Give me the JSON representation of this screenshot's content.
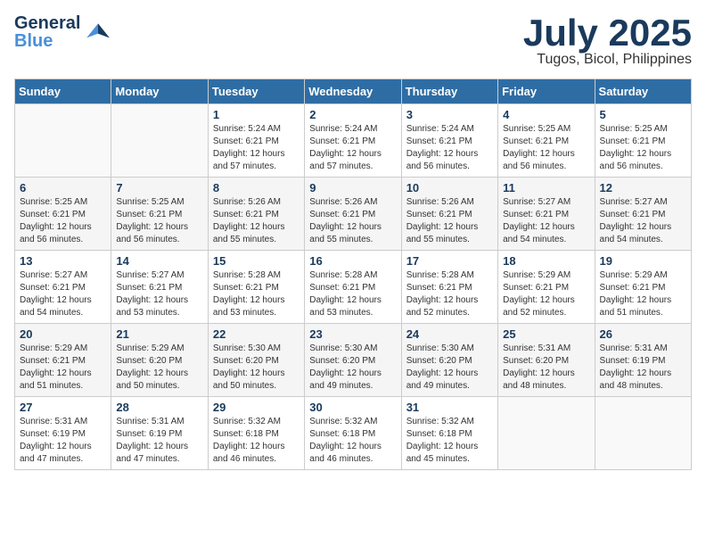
{
  "logo": {
    "general": "General",
    "blue": "Blue",
    "bird_symbol": "🐦"
  },
  "header": {
    "month": "July 2025",
    "location": "Tugos, Bicol, Philippines"
  },
  "weekdays": [
    "Sunday",
    "Monday",
    "Tuesday",
    "Wednesday",
    "Thursday",
    "Friday",
    "Saturday"
  ],
  "weeks": [
    [
      {
        "day": "",
        "info": ""
      },
      {
        "day": "",
        "info": ""
      },
      {
        "day": "1",
        "info": "Sunrise: 5:24 AM\nSunset: 6:21 PM\nDaylight: 12 hours and 57 minutes."
      },
      {
        "day": "2",
        "info": "Sunrise: 5:24 AM\nSunset: 6:21 PM\nDaylight: 12 hours and 57 minutes."
      },
      {
        "day": "3",
        "info": "Sunrise: 5:24 AM\nSunset: 6:21 PM\nDaylight: 12 hours and 56 minutes."
      },
      {
        "day": "4",
        "info": "Sunrise: 5:25 AM\nSunset: 6:21 PM\nDaylight: 12 hours and 56 minutes."
      },
      {
        "day": "5",
        "info": "Sunrise: 5:25 AM\nSunset: 6:21 PM\nDaylight: 12 hours and 56 minutes."
      }
    ],
    [
      {
        "day": "6",
        "info": "Sunrise: 5:25 AM\nSunset: 6:21 PM\nDaylight: 12 hours and 56 minutes."
      },
      {
        "day": "7",
        "info": "Sunrise: 5:25 AM\nSunset: 6:21 PM\nDaylight: 12 hours and 56 minutes."
      },
      {
        "day": "8",
        "info": "Sunrise: 5:26 AM\nSunset: 6:21 PM\nDaylight: 12 hours and 55 minutes."
      },
      {
        "day": "9",
        "info": "Sunrise: 5:26 AM\nSunset: 6:21 PM\nDaylight: 12 hours and 55 minutes."
      },
      {
        "day": "10",
        "info": "Sunrise: 5:26 AM\nSunset: 6:21 PM\nDaylight: 12 hours and 55 minutes."
      },
      {
        "day": "11",
        "info": "Sunrise: 5:27 AM\nSunset: 6:21 PM\nDaylight: 12 hours and 54 minutes."
      },
      {
        "day": "12",
        "info": "Sunrise: 5:27 AM\nSunset: 6:21 PM\nDaylight: 12 hours and 54 minutes."
      }
    ],
    [
      {
        "day": "13",
        "info": "Sunrise: 5:27 AM\nSunset: 6:21 PM\nDaylight: 12 hours and 54 minutes."
      },
      {
        "day": "14",
        "info": "Sunrise: 5:27 AM\nSunset: 6:21 PM\nDaylight: 12 hours and 53 minutes."
      },
      {
        "day": "15",
        "info": "Sunrise: 5:28 AM\nSunset: 6:21 PM\nDaylight: 12 hours and 53 minutes."
      },
      {
        "day": "16",
        "info": "Sunrise: 5:28 AM\nSunset: 6:21 PM\nDaylight: 12 hours and 53 minutes."
      },
      {
        "day": "17",
        "info": "Sunrise: 5:28 AM\nSunset: 6:21 PM\nDaylight: 12 hours and 52 minutes."
      },
      {
        "day": "18",
        "info": "Sunrise: 5:29 AM\nSunset: 6:21 PM\nDaylight: 12 hours and 52 minutes."
      },
      {
        "day": "19",
        "info": "Sunrise: 5:29 AM\nSunset: 6:21 PM\nDaylight: 12 hours and 51 minutes."
      }
    ],
    [
      {
        "day": "20",
        "info": "Sunrise: 5:29 AM\nSunset: 6:21 PM\nDaylight: 12 hours and 51 minutes."
      },
      {
        "day": "21",
        "info": "Sunrise: 5:29 AM\nSunset: 6:20 PM\nDaylight: 12 hours and 50 minutes."
      },
      {
        "day": "22",
        "info": "Sunrise: 5:30 AM\nSunset: 6:20 PM\nDaylight: 12 hours and 50 minutes."
      },
      {
        "day": "23",
        "info": "Sunrise: 5:30 AM\nSunset: 6:20 PM\nDaylight: 12 hours and 49 minutes."
      },
      {
        "day": "24",
        "info": "Sunrise: 5:30 AM\nSunset: 6:20 PM\nDaylight: 12 hours and 49 minutes."
      },
      {
        "day": "25",
        "info": "Sunrise: 5:31 AM\nSunset: 6:20 PM\nDaylight: 12 hours and 48 minutes."
      },
      {
        "day": "26",
        "info": "Sunrise: 5:31 AM\nSunset: 6:19 PM\nDaylight: 12 hours and 48 minutes."
      }
    ],
    [
      {
        "day": "27",
        "info": "Sunrise: 5:31 AM\nSunset: 6:19 PM\nDaylight: 12 hours and 47 minutes."
      },
      {
        "day": "28",
        "info": "Sunrise: 5:31 AM\nSunset: 6:19 PM\nDaylight: 12 hours and 47 minutes."
      },
      {
        "day": "29",
        "info": "Sunrise: 5:32 AM\nSunset: 6:18 PM\nDaylight: 12 hours and 46 minutes."
      },
      {
        "day": "30",
        "info": "Sunrise: 5:32 AM\nSunset: 6:18 PM\nDaylight: 12 hours and 46 minutes."
      },
      {
        "day": "31",
        "info": "Sunrise: 5:32 AM\nSunset: 6:18 PM\nDaylight: 12 hours and 45 minutes."
      },
      {
        "day": "",
        "info": ""
      },
      {
        "day": "",
        "info": ""
      }
    ]
  ]
}
